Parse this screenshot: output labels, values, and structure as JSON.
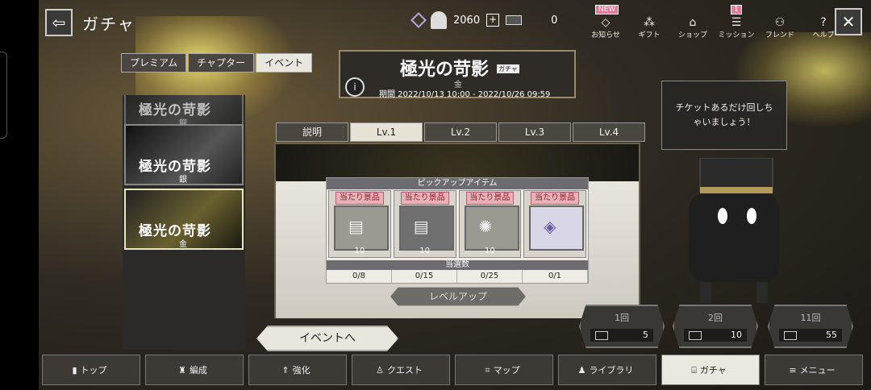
{
  "topbar": {
    "title": "ガチャ",
    "back_icon": "arrow-left-icon"
  },
  "resources": {
    "gem_count": "2060",
    "ticket_count": "0"
  },
  "top_icons": [
    {
      "label": "お知らせ",
      "icon": "bell-icon",
      "badge": "NEW"
    },
    {
      "label": "ギフト",
      "icon": "gift-icon",
      "badge": ""
    },
    {
      "label": "ショップ",
      "icon": "shop-icon",
      "badge": ""
    },
    {
      "label": "ミッション",
      "icon": "mission-icon",
      "badge": "1"
    },
    {
      "label": "フレンド",
      "icon": "friend-icon",
      "badge": ""
    },
    {
      "label": "ヘルプ",
      "icon": "help-icon",
      "badge": ""
    }
  ],
  "category_tabs": [
    "プレミアム",
    "チャプター",
    "イベント"
  ],
  "banners": [
    {
      "title": "極光の苛影",
      "sub": "銅"
    },
    {
      "title": "極光の苛影",
      "sub": "銀"
    },
    {
      "title": "極光の苛影",
      "sub": "金"
    }
  ],
  "header": {
    "title": "極光の苛影",
    "tag": "ガチャ",
    "rank": "金",
    "period": "期間 2022/10/13 10:00 - 2022/10/26 09:59"
  },
  "level_tabs": [
    "説明",
    "Lv.1",
    "Lv.2",
    "Lv.3",
    "Lv.4"
  ],
  "pickup": {
    "title": "ピックアップアイテム",
    "prize_label": "当たり景品",
    "items": [
      {
        "qty": "10",
        "icon": "book-icon"
      },
      {
        "qty": "10",
        "icon": "book-dark-icon"
      },
      {
        "qty": "10",
        "icon": "pinwheel-icon"
      },
      {
        "qty": "",
        "icon": "ticket-icon"
      }
    ],
    "win_label": "当選数",
    "counts": [
      "0/8",
      "0/15",
      "0/25",
      "0/1"
    ]
  },
  "levelup_label": "レベルアップ",
  "event_button": "イベントへ",
  "speech": "チケットあるだけ回しちゃいましょう！",
  "rolls": [
    {
      "label": "1回",
      "cost": "5"
    },
    {
      "label": "2回",
      "cost": "10"
    },
    {
      "label": "11回",
      "cost": "55"
    }
  ],
  "bottom_nav": [
    {
      "label": "トップ",
      "icon": "home-icon"
    },
    {
      "label": "編成",
      "icon": "formation-icon"
    },
    {
      "label": "強化",
      "icon": "upgrade-icon"
    },
    {
      "label": "クエスト",
      "icon": "quest-icon"
    },
    {
      "label": "マップ",
      "icon": "map-icon"
    },
    {
      "label": "ライブラリ",
      "icon": "library-icon"
    },
    {
      "label": "ガチャ",
      "icon": "gacha-icon"
    },
    {
      "label": "メニュー",
      "icon": "menu-icon"
    }
  ]
}
